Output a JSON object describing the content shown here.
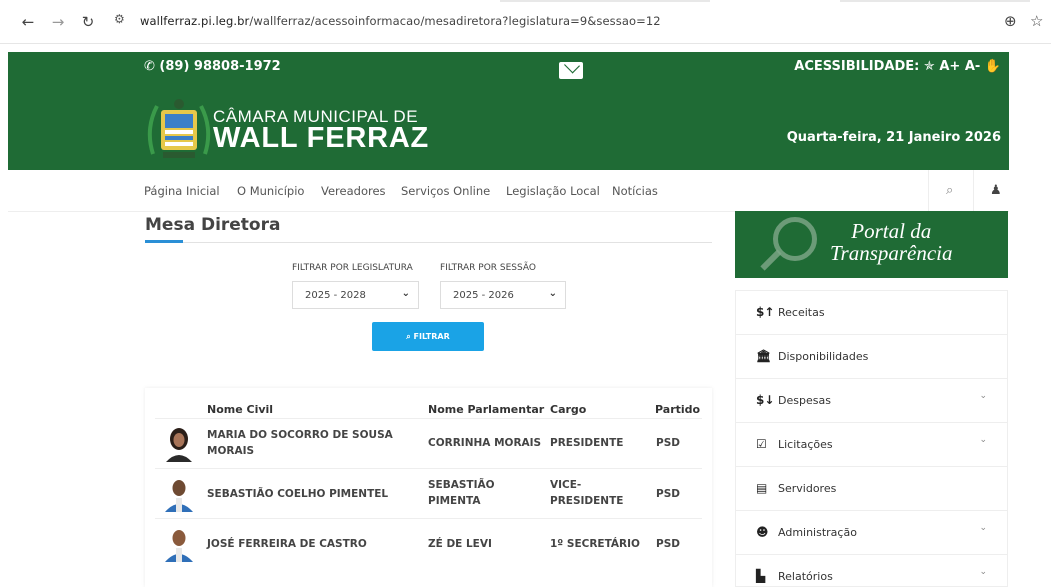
{
  "browser": {
    "url_host": "wallferraz.pi.leg.br",
    "url_path": "/wallferraz/acessoinformacao/mesadiretora?legislatura=9&sessao=12"
  },
  "header": {
    "phone": "(89) 98808-1972",
    "accessibility_label": "ACESSIBILIDADE:",
    "font_increase": "A+",
    "font_decrease": "A-",
    "title_top": "CÂMARA MUNICIPAL DE",
    "title_main": "WALL FERRAZ",
    "date": "Quarta-feira, 21 Janeiro 2026",
    "color": "#1f6b35"
  },
  "nav": {
    "items": [
      "Página Inicial",
      "O Município",
      "Vereadores",
      "Serviços Online",
      "Legislação Local",
      "Notícias"
    ]
  },
  "page": {
    "title": "Mesa Diretora"
  },
  "filters": {
    "legislatura_label": "FILTRAR POR LEGISLATURA",
    "legislatura_value": "2025 - 2028",
    "sessao_label": "FILTRAR POR SESSÃO",
    "sessao_value": "2025 - 2026",
    "button_label": "FILTRAR",
    "button_color": "#1aa3e6"
  },
  "table": {
    "headers": [
      "Nome Civil",
      "Nome Parlamentar",
      "Cargo",
      "Partido"
    ],
    "rows": [
      {
        "nome_civil": "MARIA DO SOCORRO DE SOUSA MORAIS",
        "nome_parlamentar": "CORRINHA MORAIS",
        "cargo": "PRESIDENTE",
        "partido": "PSD"
      },
      {
        "nome_civil": "SEBASTIÃO COELHO PIMENTEL",
        "nome_parlamentar": "SEBASTIÃO PIMENTA",
        "cargo": "VICE-PRESIDENTE",
        "partido": "PSD"
      },
      {
        "nome_civil": "JOSÉ FERREIRA DE CASTRO",
        "nome_parlamentar": "ZÉ DE LEVI",
        "cargo": "1º SECRETÁRIO",
        "partido": "PSD"
      }
    ]
  },
  "sidebar": {
    "portal_line1": "Portal da",
    "portal_line2": "Transparência",
    "items": [
      {
        "label": "Receitas",
        "icon": "dollar-up-icon",
        "has_chevron": false
      },
      {
        "label": "Disponibilidades",
        "icon": "bank-icon",
        "has_chevron": false
      },
      {
        "label": "Despesas",
        "icon": "dollar-down-icon",
        "has_chevron": true
      },
      {
        "label": "Licitações",
        "icon": "checkbox-icon",
        "has_chevron": true
      },
      {
        "label": "Servidores",
        "icon": "id-card-icon",
        "has_chevron": false
      },
      {
        "label": "Administração",
        "icon": "users-icon",
        "has_chevron": true
      },
      {
        "label": "Relatórios",
        "icon": "file-icon",
        "has_chevron": true
      }
    ]
  }
}
